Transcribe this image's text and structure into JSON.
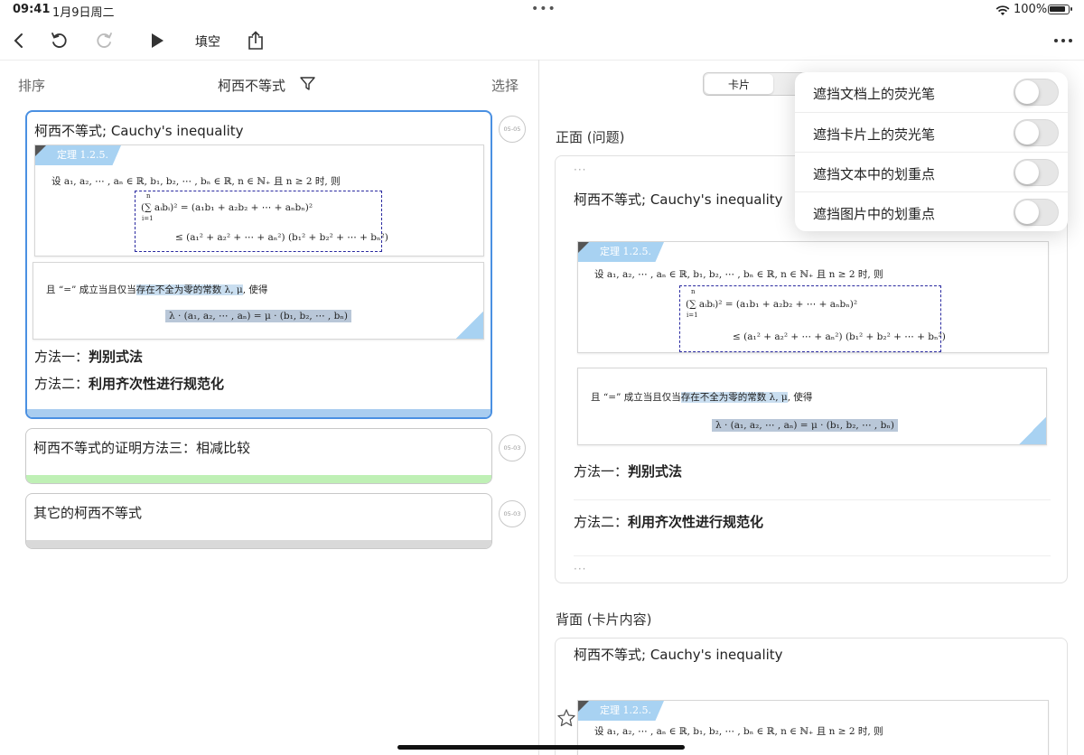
{
  "status": {
    "time": "09:41",
    "date": "1月9日周二",
    "battery": "100%"
  },
  "toolbar": {
    "back": "back-icon",
    "undo": "undo-icon",
    "redo": "redo-icon",
    "play": "play-icon",
    "fill_label": "填空",
    "share": "share-icon",
    "more": "more-icon"
  },
  "left": {
    "sort": "排序",
    "filter_title": "柯西不等式",
    "select": "选择",
    "cards": [
      {
        "title": "柯西不等式; Cauchy's inequality",
        "date": "05-05",
        "bar_color": "#a9cdf0",
        "method1_prefix": "方法一：",
        "method1": "判别式法",
        "method2_prefix": "方法二：",
        "method2": "利用齐次性进行规范化"
      },
      {
        "title": "柯西不等式的证明方法三：相减比较",
        "date": "05-03",
        "bar_color": "#bff0b5"
      },
      {
        "title": "其它的柯西不等式",
        "date": "05-03",
        "bar_color": "#d9d9d9"
      }
    ]
  },
  "scan": {
    "tag": "定理 1.2.5.",
    "line1": "设 a₁, a₂, ⋯ , aₙ ∈ ℝ, b₁, b₂, ⋯ , bₙ ∈ ℝ, n ∈ ℕ₊ 且 n ≥ 2 时, 则",
    "eq1": "(∑ aᵢbᵢ)² = (a₁b₁ + a₂b₂ + ⋯ + aₙbₙ)²",
    "eq1_top": "n",
    "eq1_bottom": "i=1",
    "eq2": "≤ (a₁² + a₂² + ⋯ + aₙ²) (b₁² + b₂² + ⋯ + bₙ²)",
    "cond_prefix": "且 “=” 成立当且仅当",
    "cond_hl": "存在不全为零的常数 λ, μ",
    "cond_suffix": ", 使得",
    "eq3": "λ · (a₁, a₂, ⋯ , aₙ) = μ · (b₁, b₂, ⋯ , bₙ)"
  },
  "right": {
    "seg_card": "卡片",
    "front_label": "正面 (问题)",
    "back_label": "背面 (卡片内容)",
    "ellipsis": "···",
    "card_title": "柯西不等式; Cauchy's inequality",
    "method1_prefix": "方法一：",
    "method1": "判别式法",
    "method2_prefix": "方法二：",
    "method2": "利用齐次性进行规范化"
  },
  "popover": {
    "items": [
      {
        "label": "遮挡文档上的荧光笔",
        "on": false
      },
      {
        "label": "遮挡卡片上的荧光笔",
        "on": false
      },
      {
        "label": "遮挡文本中的划重点",
        "on": false
      },
      {
        "label": "遮挡图片中的划重点",
        "on": false
      }
    ]
  }
}
